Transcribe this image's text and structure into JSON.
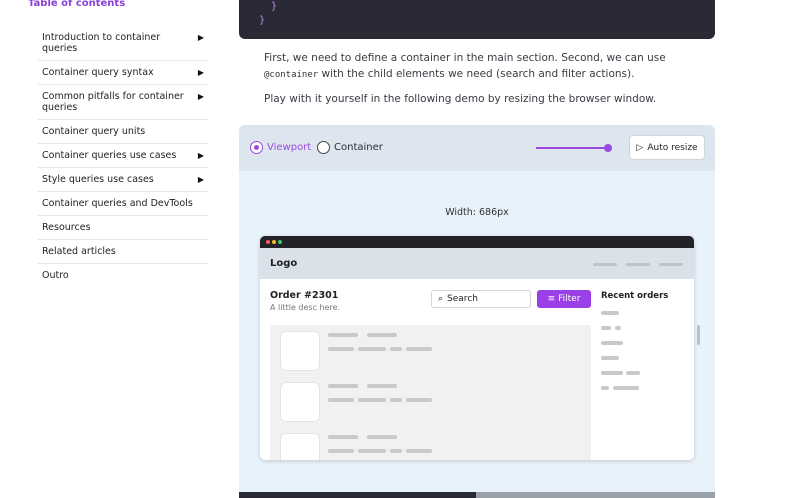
{
  "toc": {
    "title": "Table of contents",
    "items": [
      {
        "label": "Introduction to container queries",
        "caret": "▶"
      },
      {
        "label": "Container query syntax",
        "caret": "▶"
      },
      {
        "label": "Common pitfalls for container queries",
        "caret": "▶"
      },
      {
        "label": "Container query units",
        "caret": ""
      },
      {
        "label": "Container queries use cases",
        "caret": "▶"
      },
      {
        "label": "Style queries use cases",
        "caret": "▶"
      },
      {
        "label": "Container queries and DevTools",
        "caret": ""
      },
      {
        "label": "Resources",
        "caret": ""
      },
      {
        "label": "Related articles",
        "caret": ""
      },
      {
        "label": "Outro",
        "caret": ""
      }
    ]
  },
  "code": {
    "line1": "  }",
    "line2": "}"
  },
  "prose": {
    "p1_a": "First, we need to define a container in the main section. Second, we can use ",
    "p1_code": "@container",
    "p1_b": " with the child elements we need (search and filter actions).",
    "p2": "Play with it yourself in the following demo by resizing the browser window."
  },
  "demo": {
    "radio_viewport": "Viewport",
    "radio_container": "Container",
    "selected_mode": "Viewport",
    "slider_value_percent": 95,
    "auto_resize": "Auto resize",
    "width_label": "Width: 686px",
    "accent_color": "#9b4ae0",
    "browser": {
      "logo": "Logo",
      "order_title": "Order #2301",
      "order_desc": "A little desc here.",
      "search_label": "Search",
      "filter_label": "Filter",
      "recent_title": "Recent orders"
    }
  }
}
